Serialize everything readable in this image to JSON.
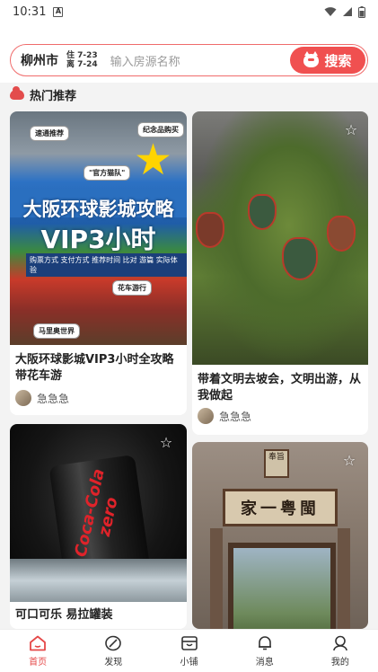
{
  "status_bar": {
    "time": "10:31",
    "notification_icon": "A"
  },
  "search": {
    "city": "柳州市",
    "checkin_label": "住 7-23",
    "checkout_label": "离 7-24",
    "placeholder": "输入房源名称",
    "button_label": "搜索"
  },
  "section": {
    "title": "热门推荐"
  },
  "cards": [
    {
      "title": "大阪环球影城VIP3小时全攻略带花车游",
      "author": "急急急",
      "image_text": {
        "headline1": "大阪环球影城攻略",
        "headline2": "VIP3小时",
        "subline": "购票方式 支付方式 推荐时间 比对 游篇 实际体验",
        "tag1": "速通推荐",
        "tag2": "纪念品购买",
        "tag3": "\"官方猫队\"",
        "tag4": "花车游行",
        "tag5": "马里奥世界"
      }
    },
    {
      "title": "带着文明去坡会，文明出游，从我做起",
      "author": "急急急"
    },
    {
      "title": "可口可乐 易拉罐装",
      "image_text": {
        "brand": "Coca-Cola zero"
      }
    },
    {
      "title": "",
      "image_text": {
        "plaque": "家一粤閩",
        "top_sign": "奉旨"
      }
    }
  ],
  "nav": [
    {
      "label": "首页",
      "icon": "home-icon",
      "active": true
    },
    {
      "label": "发现",
      "icon": "discover-icon",
      "active": false
    },
    {
      "label": "小铺",
      "icon": "shop-icon",
      "active": false
    },
    {
      "label": "消息",
      "icon": "bell-icon",
      "active": false
    },
    {
      "label": "我的",
      "icon": "profile-icon",
      "active": false
    }
  ],
  "colors": {
    "accent": "#f05050",
    "active_nav": "#e54848"
  }
}
